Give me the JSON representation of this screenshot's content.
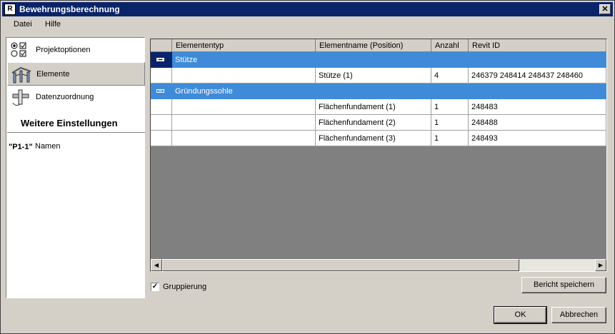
{
  "window": {
    "title": "Bewehrungsberechnung",
    "app_icon": "R",
    "close_glyph": "✕"
  },
  "menu": {
    "items": [
      "Datei",
      "Hilfe"
    ]
  },
  "sidebar": {
    "items": [
      {
        "label": "Projektoptionen",
        "icon": "options-icon"
      },
      {
        "label": "Elemente",
        "icon": "structure-icon"
      },
      {
        "label": "Datenzuordnung",
        "icon": "mapping-icon"
      }
    ],
    "heading": "Weitere Einstellungen",
    "name_item": {
      "icon_text": "\"P1-1\"",
      "label": "Namen"
    }
  },
  "grid": {
    "columns": [
      "Elemententyp",
      "Elementname (Position)",
      "Anzahl",
      "Revit ID"
    ],
    "rows": [
      {
        "type": "group",
        "label": "Stütze",
        "selected": true
      },
      {
        "type": "data",
        "elementtyp": "",
        "name": "Stütze (1)",
        "anzahl": "4",
        "revit_id": "246379 248414 248437 248460"
      },
      {
        "type": "group",
        "label": "Gründungssohle",
        "selected": false
      },
      {
        "type": "data",
        "elementtyp": "",
        "name": "Flächenfundament (1)",
        "anzahl": "1",
        "revit_id": "248483"
      },
      {
        "type": "data",
        "elementtyp": "",
        "name": "Flächenfundament (2)",
        "anzahl": "1",
        "revit_id": "248488"
      },
      {
        "type": "data",
        "elementtyp": "",
        "name": "Flächenfundament (3)",
        "anzahl": "1",
        "revit_id": "248493"
      }
    ]
  },
  "grouping": {
    "label": "Gruppierung",
    "checked": true,
    "check_glyph": "✓"
  },
  "buttons": {
    "save_report": "Bericht speichern",
    "ok": "OK",
    "cancel": "Abbrechen"
  },
  "scrollbar": {
    "left_arrow": "◀",
    "right_arrow": "▶"
  },
  "colors": {
    "group_row": "#3f8bd9",
    "selected_header": "#0a246a",
    "grid_bg": "#808080"
  }
}
